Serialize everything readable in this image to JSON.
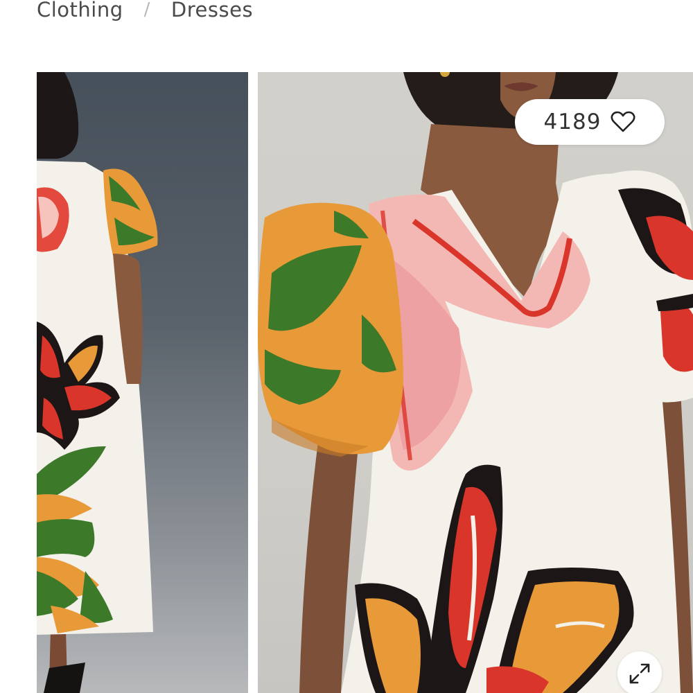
{
  "breadcrumb": {
    "items": [
      "Clothing",
      "Dresses"
    ],
    "separator": "/"
  },
  "gallery": {
    "images": [
      {
        "view": "back",
        "icon": "product-photo-back-icon"
      },
      {
        "view": "front",
        "icon": "product-photo-front-icon"
      }
    ],
    "likes": {
      "count": "4189",
      "icon": "heart-icon"
    },
    "expand": {
      "icon": "expand-icon"
    }
  },
  "colors": {
    "text": "#4a4a4a",
    "dress_white": "#f3f1ea",
    "orange": "#e89a38",
    "red": "#d9352b",
    "green": "#3c7a2a",
    "black": "#1c1716",
    "skin": "#8a5a3f"
  }
}
